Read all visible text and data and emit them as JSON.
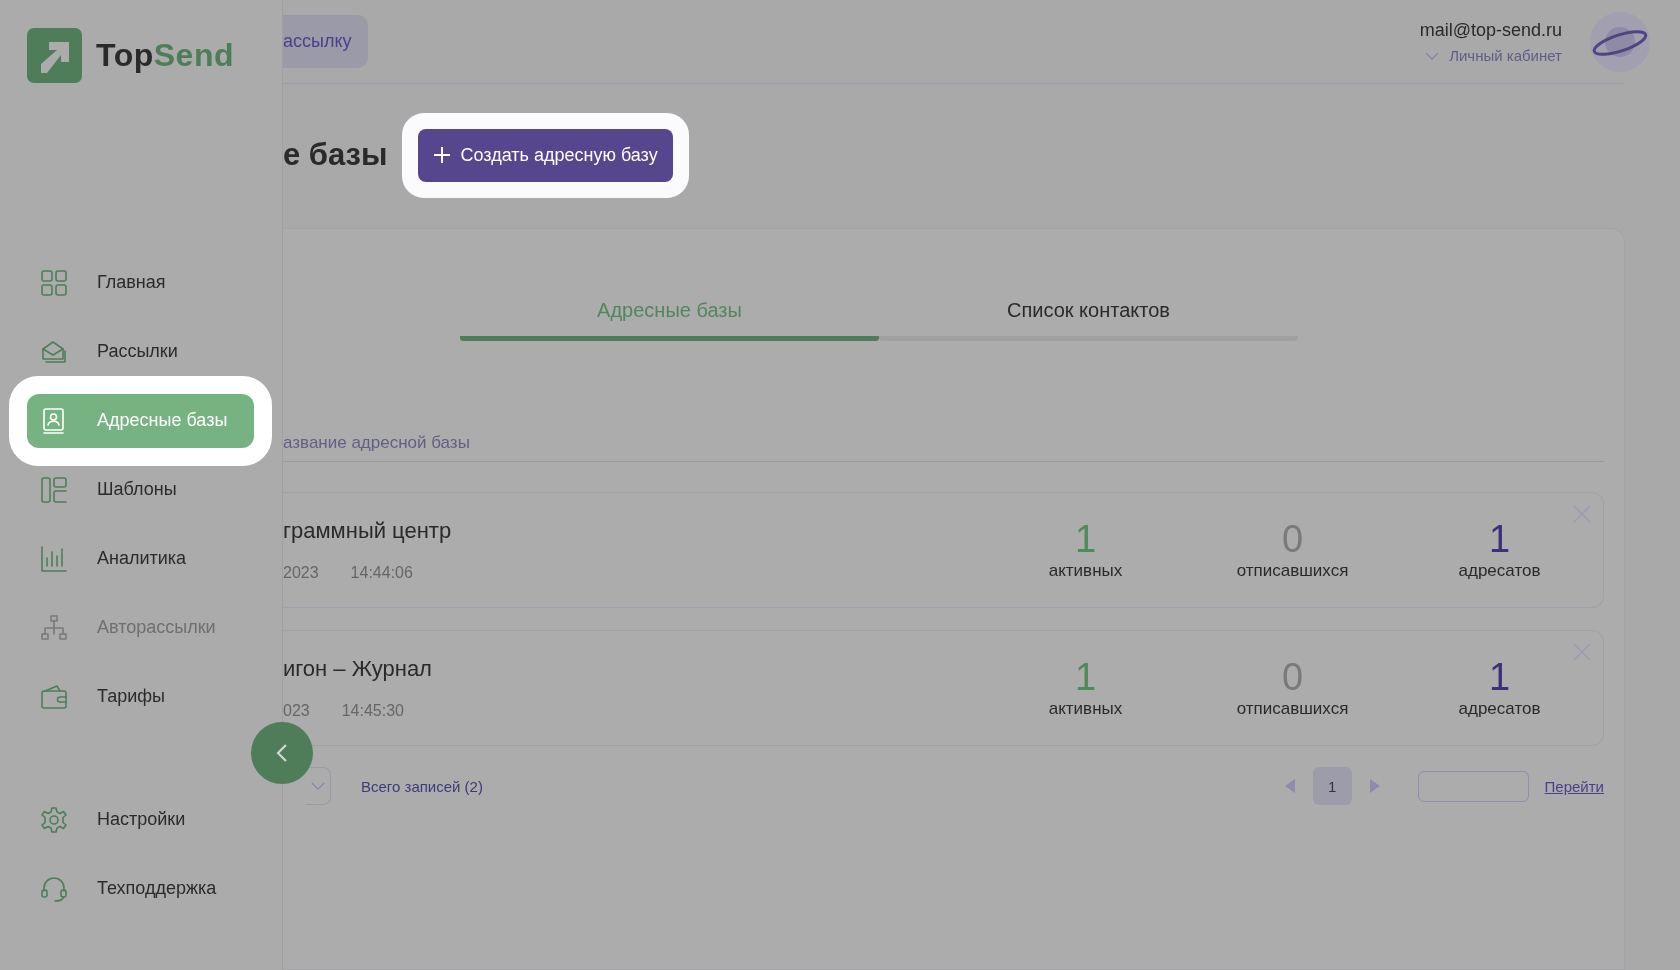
{
  "sidebar": {
    "logo": {
      "part_1": "Top",
      "part_2": "Send"
    },
    "items": [
      {
        "label": "Главная",
        "selected": false,
        "disabled": false,
        "highlighted": false
      },
      {
        "label": "Рассылки",
        "selected": false,
        "disabled": false,
        "highlighted": false
      },
      {
        "label": "Адресные базы",
        "selected": true,
        "disabled": false,
        "highlighted": true
      },
      {
        "label": "Шаблоны",
        "selected": false,
        "disabled": false,
        "highlighted": false
      },
      {
        "label": "Аналитика",
        "selected": false,
        "disabled": false,
        "highlighted": false
      },
      {
        "label": "Авторассылки",
        "selected": false,
        "disabled": true,
        "highlighted": false
      },
      {
        "label": "Тарифы",
        "selected": false,
        "disabled": false,
        "highlighted": false
      }
    ],
    "bottom_items": [
      {
        "label": "Настройки",
        "selected": false,
        "disabled": false,
        "highlighted": false
      },
      {
        "label": "Техподдержка",
        "selected": false,
        "disabled": false,
        "highlighted": false
      }
    ]
  },
  "header": {
    "partial_button": "ассылку",
    "email": "mail@top-send.ru",
    "account_link": "Личный кабинет"
  },
  "page": {
    "title": "е базы",
    "create_button": {
      "label": "Создать адресную базу",
      "highlighted": true
    }
  },
  "tabs": [
    {
      "label": "Адресные базы",
      "selected": true
    },
    {
      "label": "Список контактов",
      "selected": false
    }
  ],
  "search": {
    "placeholder": "азвание адресной базы"
  },
  "rows": [
    {
      "name": "граммный центр",
      "date": "2023",
      "time": "14:44:06",
      "stats": [
        {
          "kind": "active",
          "value": "1",
          "label": "активных"
        },
        {
          "kind": "unsubscribed",
          "value": "0",
          "label": "отписавшихся"
        },
        {
          "kind": "total",
          "value": "1",
          "label": "адресатов"
        }
      ]
    },
    {
      "name": "игон – Журнал",
      "date": "023",
      "time": "14:45:30",
      "stats": [
        {
          "kind": "active",
          "value": "1",
          "label": "активных"
        },
        {
          "kind": "unsubscribed",
          "value": "0",
          "label": "отписавшихся"
        },
        {
          "kind": "total",
          "value": "1",
          "label": "адресатов"
        }
      ]
    }
  ],
  "pagination": {
    "total": "Всего записей (2)",
    "pages": [
      {
        "label": "1",
        "selected": true
      }
    ],
    "go_link": "Перейти"
  }
}
